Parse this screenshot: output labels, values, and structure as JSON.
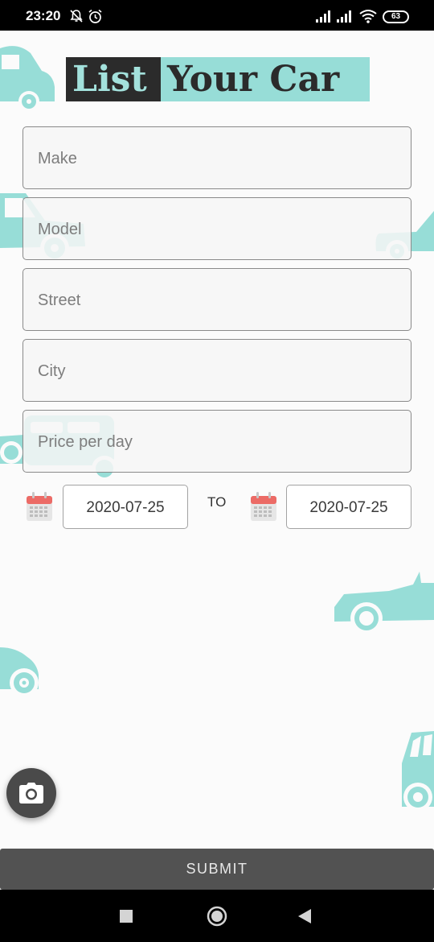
{
  "status_bar": {
    "time": "23:20",
    "battery": "63",
    "icons": [
      "bell-off-icon",
      "alarm-icon",
      "signal-icon",
      "signal-icon",
      "wifi-icon",
      "battery-icon"
    ]
  },
  "header": {
    "title_part1": "List",
    "title_part2": "Your Car"
  },
  "form": {
    "make_placeholder": "Make",
    "model_placeholder": "Model",
    "street_placeholder": "Street",
    "city_placeholder": "City",
    "price_placeholder": "Price per day"
  },
  "dates": {
    "start": "2020-07-25",
    "to_label": "TO",
    "end": "2020-07-25"
  },
  "actions": {
    "submit_label": "SUBMIT"
  },
  "colors": {
    "accent": "#97ddd7",
    "dark": "#2b2b2b",
    "submit_bg": "#525252"
  }
}
